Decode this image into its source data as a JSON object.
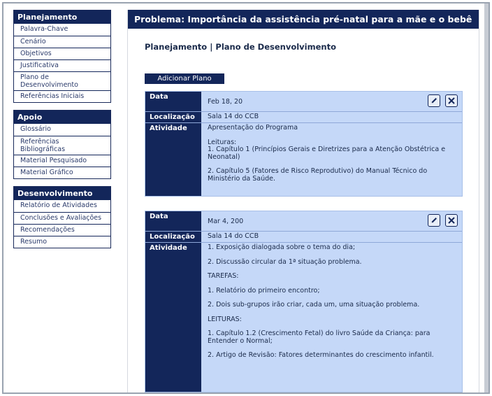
{
  "sidebar": {
    "groups": [
      {
        "title": "Planejamento",
        "items": [
          "Palavra-Chave",
          "Cenário",
          "Objetivos",
          "Justificativa",
          "Plano de Desenvolvimento",
          "Referências Iniciais"
        ]
      },
      {
        "title": "Apoio",
        "items": [
          "Glossário",
          "Referências Bibliográficas",
          "Material Pesquisado",
          "Material Gráfico"
        ]
      },
      {
        "title": "Desenvolvimento",
        "items": [
          "Relatório de Atividades",
          "Conclusões e Avaliações",
          "Recomendações",
          "Resumo"
        ]
      }
    ]
  },
  "main": {
    "title": "Problema: Importância da assistência pré-natal para a mãe e o bebê",
    "subtitle": "Planejamento | Plano de Desenvolvimento",
    "add_button": "Adicionar Plano",
    "labels": {
      "date": "Data",
      "location": "Localização",
      "activity": "Atividade"
    },
    "plans": [
      {
        "date": "Feb 18, 20",
        "location": "Sala 14 do CCB",
        "activity": [
          "Apresentação do Programa",
          "Leituras:\n1. Capítulo 1 (Princípios Gerais e Diretrizes para a Atenção Obstétrica e Neonatal)",
          "2. Capítulo 5 (Fatores de Risco Reprodutivo) do Manual Técnico do Ministério da Saúde."
        ]
      },
      {
        "date": "Mar 4, 200",
        "location": "Sala 14 do CCB",
        "activity": [
          "1. Exposição dialogada sobre o tema do dia;",
          "2. Discussão circular da 1ª situação problema.",
          "TAREFAS:",
          "1. Relatório do primeiro encontro;",
          "2. Dois sub-grupos irão criar, cada um, uma situação problema.",
          "LEITURAS:",
          "1. Capítulo 1.2 (Crescimento Fetal) do livro Saúde da Criança: para Entender o Normal;",
          "2. Artigo de Revisão: Fatores determinantes do crescimento infantil."
        ]
      }
    ]
  },
  "icons": {
    "edit": "pencil-icon",
    "delete": "close-icon"
  },
  "colors": {
    "navy": "#13265a",
    "card_bg": "#c5d8f8"
  }
}
